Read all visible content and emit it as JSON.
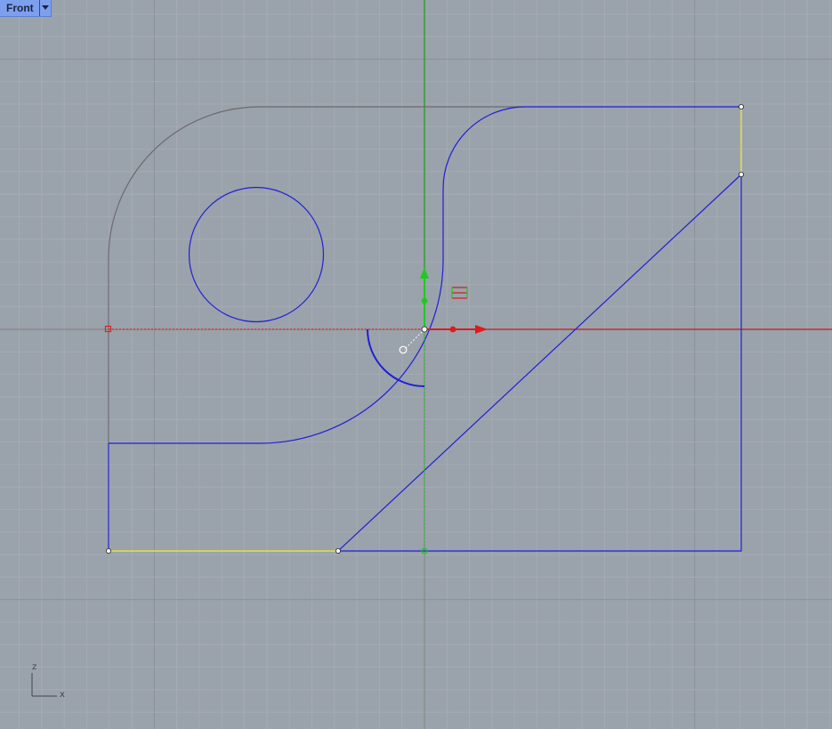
{
  "viewport": {
    "name": "Front",
    "menu_icon": "dropdown-triangle-icon"
  },
  "axis_widget": {
    "vertical_label": "z",
    "horizontal_label": "x"
  },
  "colors": {
    "background": "#9aa2ab",
    "grid_minor": "#a7adb5",
    "grid_major": "#8a9097",
    "curve": "#1f1fd8",
    "selected_edge": "#e8e04a",
    "hidden_curve": "#6b6b70",
    "x_axis": "#c81a1a",
    "z_axis": "#1fa01f",
    "tab": "#7da0ee"
  },
  "gumball_icons": [
    "move-x-arrow-icon",
    "move-z-arrow-icon",
    "rotate-arc-icon",
    "scale-handle-icon",
    "gumball-menu-icon"
  ]
}
